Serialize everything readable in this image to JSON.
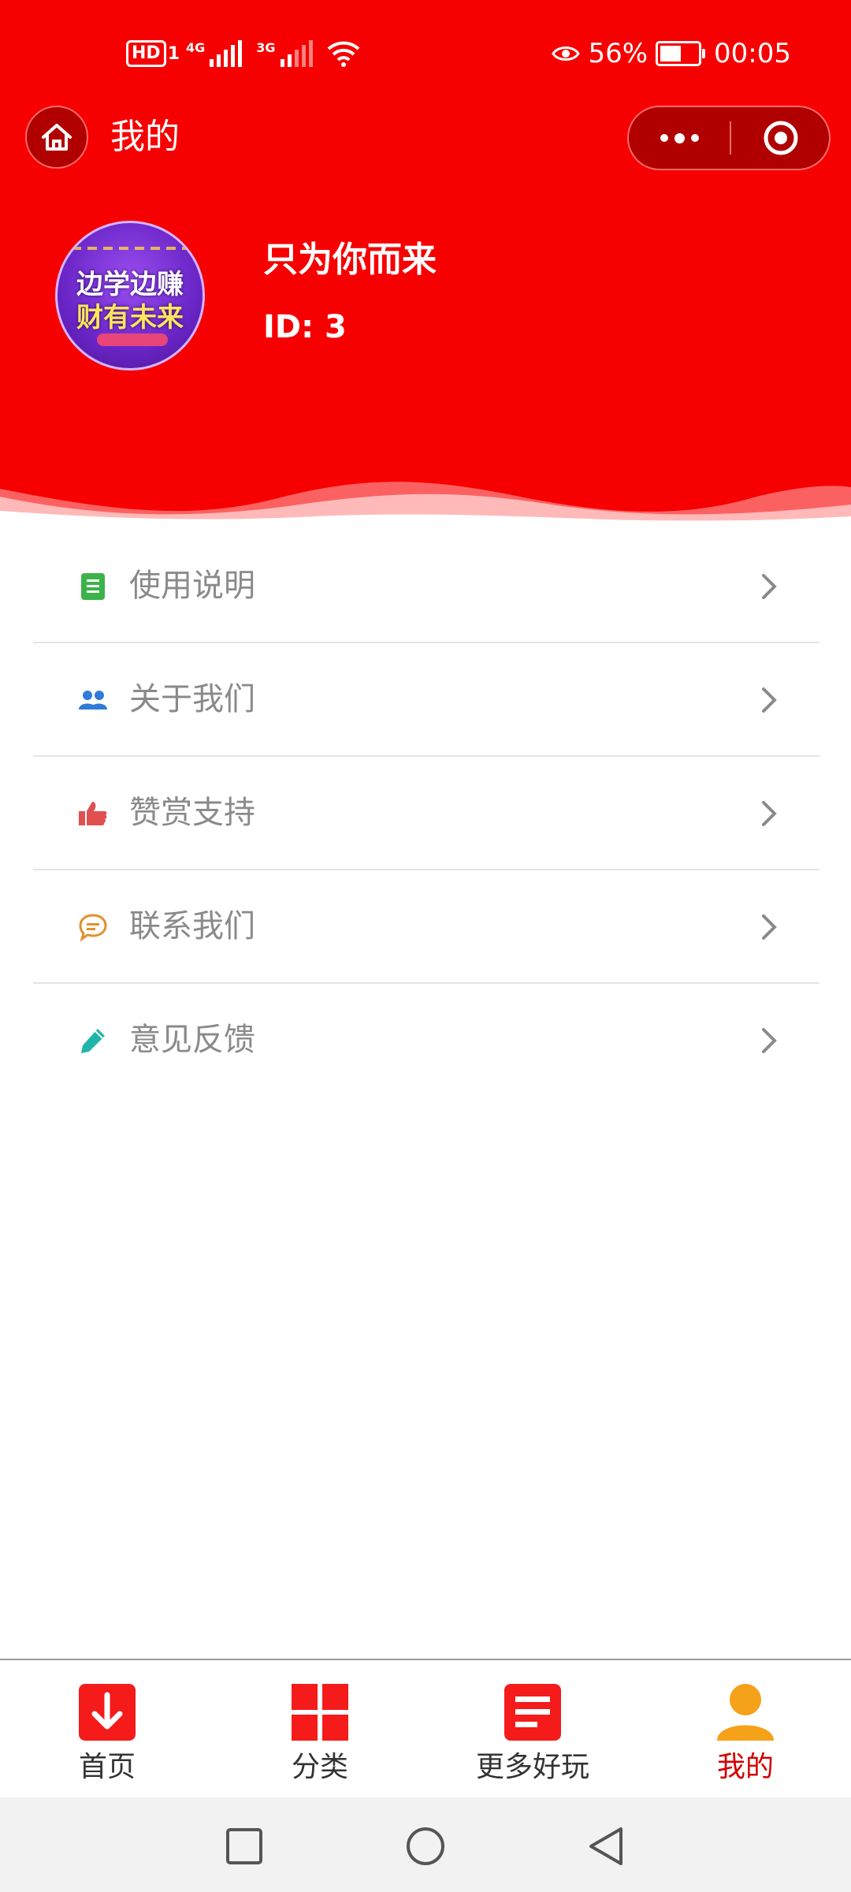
{
  "status_bar": {
    "hd_badge": "HD",
    "sim_indicator": "1",
    "network_1": "4G",
    "network_2": "3G",
    "battery_percent": "56%",
    "battery_level": 0.56,
    "time": "00:05",
    "icons": [
      "eye-icon",
      "wifi-icon",
      "battery-icon",
      "signal-icon"
    ]
  },
  "nav": {
    "title": "我的",
    "home_icon": "home-icon",
    "more_icon": "more-dots-icon",
    "close_icon": "target-close-icon"
  },
  "profile": {
    "avatar_text_line1": "边学边赚",
    "avatar_text_line2": "财有未来",
    "name": "只为你而来",
    "id_text": "ID: 3"
  },
  "menu": {
    "items": [
      {
        "label": "使用说明",
        "icon": "document-icon",
        "color": "#3cb34a"
      },
      {
        "label": "关于我们",
        "icon": "users-icon",
        "color": "#2f7bd8"
      },
      {
        "label": "赞赏支持",
        "icon": "thumbs-up-icon",
        "color": "#e05050"
      },
      {
        "label": "联系我们",
        "icon": "chat-bubble-icon",
        "color": "#e0922e"
      },
      {
        "label": "意见反馈",
        "icon": "pencil-icon",
        "color": "#1fb5a8"
      }
    ]
  },
  "tabbar": {
    "tabs": [
      {
        "label": "首页",
        "icon": "download-icon",
        "active": false
      },
      {
        "label": "分类",
        "icon": "grid-icon",
        "active": false
      },
      {
        "label": "更多好玩",
        "icon": "list-icon",
        "active": false
      },
      {
        "label": "我的",
        "icon": "user-icon",
        "active": true
      }
    ]
  },
  "system_nav": {
    "buttons": [
      "recent-apps-icon",
      "home-circle-icon",
      "back-triangle-icon"
    ]
  },
  "colors": {
    "header_red": "#f60001",
    "tab_active": "#d40000",
    "tab_user_orange": "#f5a11a",
    "menu_text": "#8a8a8a"
  }
}
